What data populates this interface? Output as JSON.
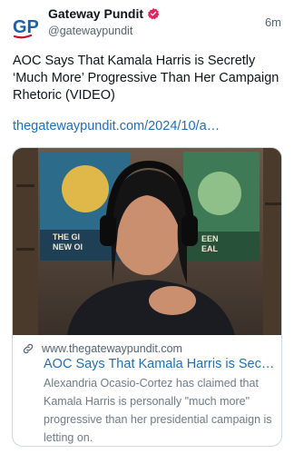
{
  "post": {
    "author": {
      "name": "Gateway Pundit",
      "handle": "@gatewaypundit",
      "avatar_text": "GP",
      "verified": true
    },
    "time": "6m",
    "text": "AOC Says That Kamala Harris is Secretly ‘Much More’ Progressive Than Her Campaign Rhetoric (VIDEO)",
    "link": "thegatewaypundit.com/2024/10/a…",
    "card": {
      "domain": "www.thegatewaypundit.com",
      "title": "AOC Says That Kamala Harris is Secretly ‘Much More’ Progressive Than Her Campaign Rhetoric (VIDEO)",
      "description": "Alexandria Ocasio-Cortez has claimed that Kamala Harris is personally \"much more\" progressive than her presidential campaign is letting on.",
      "image_poster_left": "THE GI NEW OI",
      "image_poster_right": "EEN EAL"
    }
  },
  "colors": {
    "text": "#0f1419",
    "secondary": "#536471",
    "link": "#1d6fb8",
    "verified": "#e0245e",
    "avatar_blue": "#1f5fa8",
    "avatar_red": "#c8102e",
    "border": "#cfd9de"
  },
  "icons": [
    "verified-badge-icon",
    "link-icon"
  ]
}
